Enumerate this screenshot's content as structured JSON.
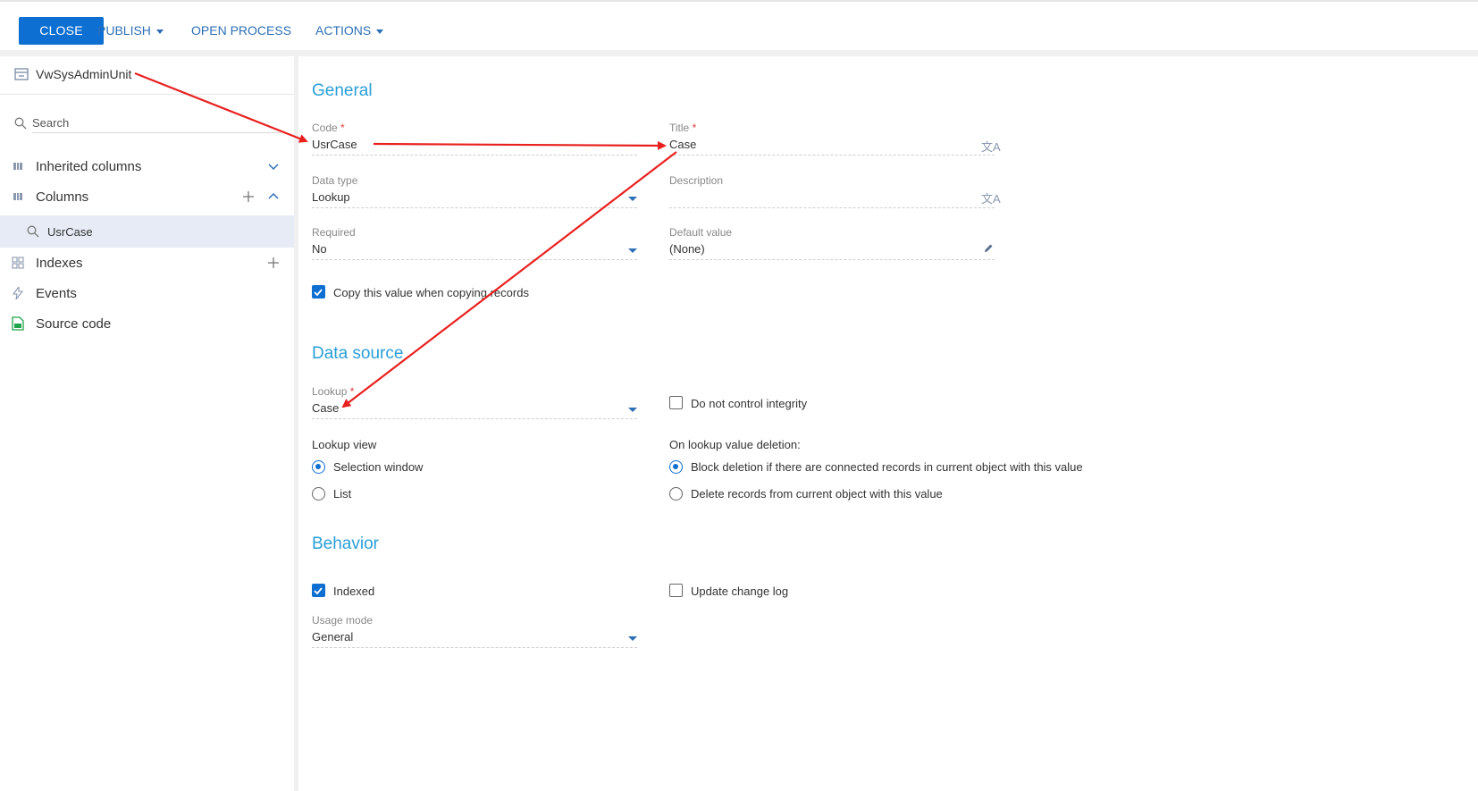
{
  "toolbar": {
    "close_label": "CLOSE",
    "publish_label": "PUBLISH",
    "open_process_label": "OPEN PROCESS",
    "actions_label": "ACTIONS"
  },
  "sidebar": {
    "object_name": "VwSysAdminUnit",
    "search_placeholder": "Search",
    "items": [
      {
        "label": "Inherited columns",
        "icon": "columns-icon"
      },
      {
        "label": "Columns",
        "icon": "columns-icon"
      },
      {
        "label": "Indexes",
        "icon": "index-icon"
      },
      {
        "label": "Events",
        "icon": "lightning-icon"
      },
      {
        "label": "Source code",
        "icon": "code-file-icon"
      }
    ],
    "selected_column": "UsrCase"
  },
  "general": {
    "title": "General",
    "code_label": "Code",
    "code_value": "UsrCase",
    "title_label": "Title",
    "title_value": "Case",
    "data_type_label": "Data type",
    "data_type_value": "Lookup",
    "description_label": "Description",
    "description_value": "",
    "required_label": "Required",
    "required_value": "No",
    "default_value_label": "Default value",
    "default_value_value": "(None)",
    "copy_value_label": "Copy this value when copying records",
    "copy_value_checked": true
  },
  "data_source": {
    "title": "Data source",
    "lookup_label": "Lookup",
    "lookup_value": "Case",
    "no_integrity_label": "Do not control integrity",
    "no_integrity_checked": false,
    "lookup_view_label": "Lookup view",
    "lookup_view_options": [
      "Selection window",
      "List"
    ],
    "lookup_view_selected": "Selection window",
    "on_deletion_label": "On lookup value deletion:",
    "on_deletion_options": [
      "Block deletion if there are connected records in current object with this value",
      "Delete records from current object with this value"
    ],
    "on_deletion_selected": "Block deletion if there are connected records in current object with this value"
  },
  "behavior": {
    "title": "Behavior",
    "indexed_label": "Indexed",
    "indexed_checked": true,
    "update_log_label": "Update change log",
    "update_log_checked": false,
    "usage_mode_label": "Usage mode",
    "usage_mode_value": "General"
  },
  "colors": {
    "accent": "#0d6fd1",
    "section_title": "#2a9fd8",
    "required_mark": "#e03b3b",
    "annotation_arrow": "#e8201e"
  }
}
